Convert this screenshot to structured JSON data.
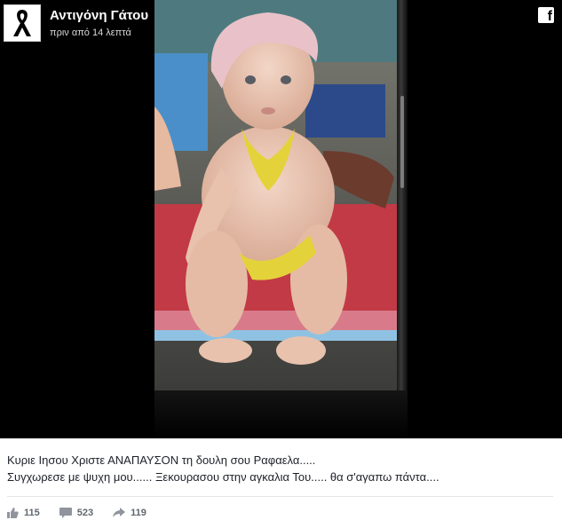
{
  "post": {
    "author": "Αντιγόνη Γάτου",
    "time": "πριν από 14 λεπτά",
    "avatar_icon": "black-ribbon-icon",
    "network_icon": "facebook-icon",
    "caption_line1": "Κυριε Ιησου Χριστε ΑΝΑΠΑΥΣΟΝ τη δουλη σου Ραφαελα.....",
    "caption_line2": "Συγχωρεσε με ψυχη μου...... Ξεκουρασου στην αγκαλια Του..... θα σ'αγαπω πάντα...."
  },
  "stats": {
    "likes": "115",
    "comments": "523",
    "shares": "119",
    "like_icon": "thumbs-up-icon",
    "comment_icon": "comment-icon",
    "share_icon": "share-arrow-icon"
  },
  "colors": {
    "background": "#000000",
    "text": "#1d2129",
    "meta": "#606770"
  }
}
